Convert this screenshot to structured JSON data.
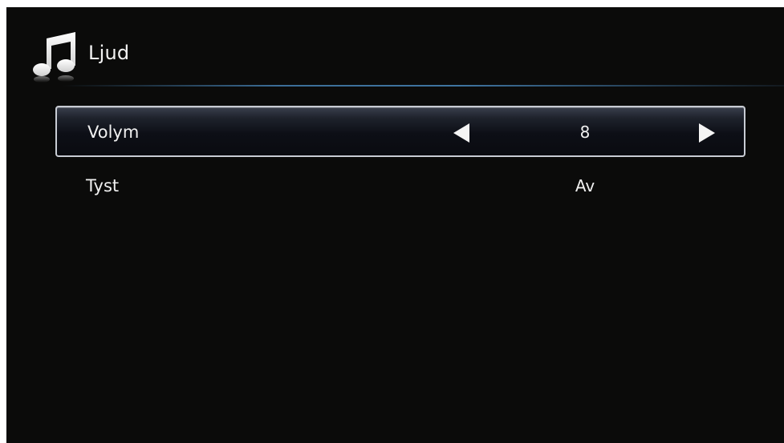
{
  "header": {
    "title": "Ljud",
    "icon": "music-note-icon"
  },
  "menu": {
    "items": [
      {
        "label": "Volym",
        "value": "8",
        "selected": true
      },
      {
        "label": "Tyst",
        "value": "Av",
        "selected": false
      }
    ]
  },
  "colors": {
    "background": "#0b0b0a",
    "text": "#f0f0f0",
    "accent_line": "#3c6e98",
    "selection_border": "#c8ccd4"
  }
}
